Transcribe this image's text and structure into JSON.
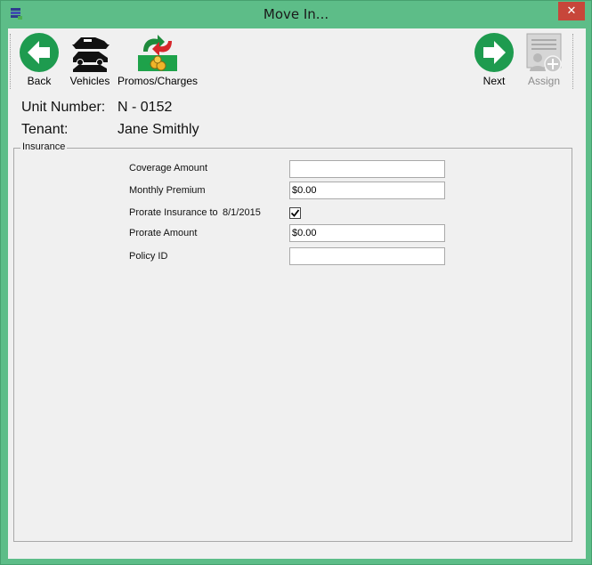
{
  "window": {
    "title": "Move In..."
  },
  "toolbar": {
    "back_label": "Back",
    "vehicles_label": "Vehicles",
    "promos_label": "Promos/Charges",
    "next_label": "Next",
    "assign_label": "Assign"
  },
  "info": {
    "unit_label": "Unit Number:",
    "unit_value": "N - 0152",
    "tenant_label": "Tenant:",
    "tenant_value": "Jane Smithly"
  },
  "insurance": {
    "group_title": "Insurance",
    "coverage_label": "Coverage Amount",
    "coverage_value": "",
    "premium_label": "Monthly Premium",
    "premium_value": "$0.00",
    "prorate_label": "Prorate Insurance to",
    "prorate_date": "8/1/2015",
    "prorate_checked": true,
    "prorate_amount_label": "Prorate Amount",
    "prorate_amount_value": "$0.00",
    "policy_label": "Policy ID",
    "policy_value": ""
  },
  "colors": {
    "frame": "#5dbd88",
    "close": "#c7463a",
    "nav_green": "#1e9b4f",
    "client_bg": "#f0f0f0"
  },
  "icons": {
    "app": "app-window-icon",
    "back": "back-arrow-icon",
    "vehicles": "vehicles-icon",
    "promos": "promos-charges-icon",
    "next": "next-arrow-icon",
    "assign": "assign-user-icon"
  }
}
